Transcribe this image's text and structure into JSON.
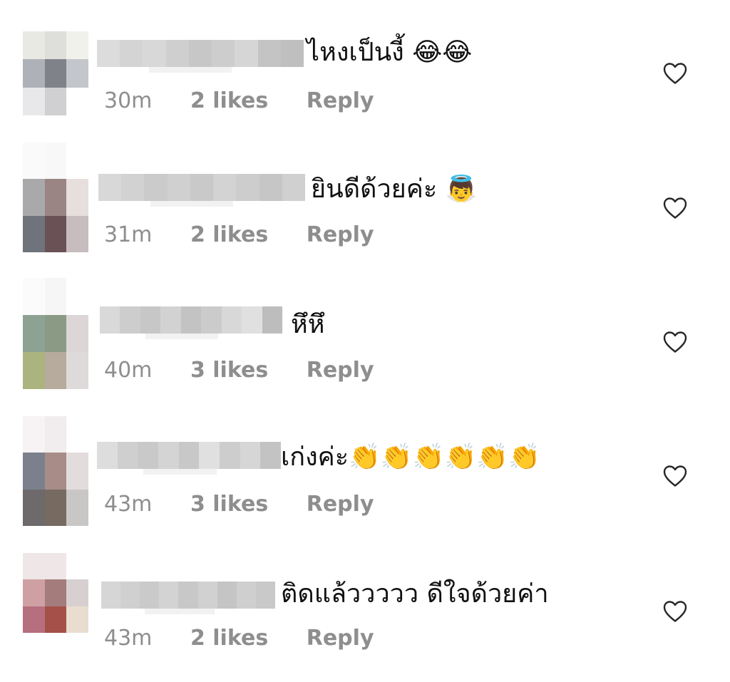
{
  "comments": [
    {
      "text": "ไหงเป็นงี้ 😂😂",
      "time": "30m",
      "likes": "2 likes",
      "reply": "Reply",
      "icon": "heart-outline-icon",
      "avatar_colors": [
        "#e9e9e4",
        "#dedfdb",
        "#f1f1ec",
        "#aeb1b7",
        "#7f8288",
        "#c3c6cb",
        "#e8e8ea",
        "#d0d0d2",
        "#ffffff"
      ],
      "blur_colors": [
        "#dcdcdc",
        "#d4d4d4",
        "#d8d8d8",
        "#cfcfcf",
        "#c7c7c7",
        "#cdcdcd",
        "#d6d6d6",
        "#c4c4c4",
        "#bfbfbf"
      ]
    },
    {
      "text": "ยินดีด้วยค่ะ 👼",
      "time": "31m",
      "likes": "2 likes",
      "reply": "Reply",
      "icon": "heart-outline-icon",
      "avatar_colors": [
        "#fafafa",
        "#f8f8f8",
        "#ffffff",
        "#a9a9ab",
        "#9a8584",
        "#e7dede",
        "#6f737c",
        "#6a5155",
        "#c7bcbe"
      ],
      "blur_colors": [
        "#d8d8d8",
        "#d2d2d2",
        "#cbcbcb",
        "#d0d0d0",
        "#c9c9c9",
        "#d3d3d3",
        "#cdcdcd",
        "#c6c6c6",
        "#d0d0d0"
      ]
    },
    {
      "text": "หึหึ",
      "time": "40m",
      "likes": "3 likes",
      "reply": "Reply",
      "icon": "heart-outline-icon",
      "avatar_colors": [
        "#fbfbfb",
        "#f6f6f6",
        "#ffffff",
        "#8ea293",
        "#8b9a85",
        "#dcd6d6",
        "#abb47f",
        "#b7ab9e",
        "#dedad9"
      ],
      "blur_colors": [
        "#d9d9d9",
        "#cdcdcd",
        "#c7c7c7",
        "#d2d2d2",
        "#c3c3c3",
        "#cbcbcb",
        "#d8d8d8",
        "#e0e0e0",
        "#bdbdbd"
      ]
    },
    {
      "text": "เก่งค่ะ👏👏👏👏👏👏",
      "time": "43m",
      "likes": "3 likes",
      "reply": "Reply",
      "icon": "heart-outline-icon",
      "avatar_colors": [
        "#f7f3f4",
        "#f1eced",
        "#ffffff",
        "#7b808c",
        "#a88c88",
        "#e3dcdc",
        "#6e6a6b",
        "#776b61",
        "#c9c6c6"
      ],
      "blur_colors": [
        "#dddddd",
        "#cfcfcf",
        "#c9c9c9",
        "#d4d4d4",
        "#c8c8c8",
        "#e0e0e0",
        "#cdcdcd",
        "#d6d6d6",
        "#c3c3c3"
      ]
    },
    {
      "text": "ติดแล้ววววว ดีใจด้วยค่า",
      "time": "43m",
      "likes": "2 likes",
      "reply": "Reply",
      "icon": "heart-outline-icon",
      "avatar_colors": [
        "#eee6e7",
        "#efe6e7",
        "#ffffff",
        "#cfa0a3",
        "#a47c7b",
        "#d8d0d0",
        "#b56f7f",
        "#a55049",
        "#e9ddd0"
      ],
      "blur_colors": [
        "#d6d6d6",
        "#d0d0d0",
        "#cacaca",
        "#d3d3d3",
        "#c8c8c8",
        "#d1d1d1",
        "#c5c5c5",
        "#cfcfcf",
        "#c9c9c9"
      ]
    }
  ]
}
